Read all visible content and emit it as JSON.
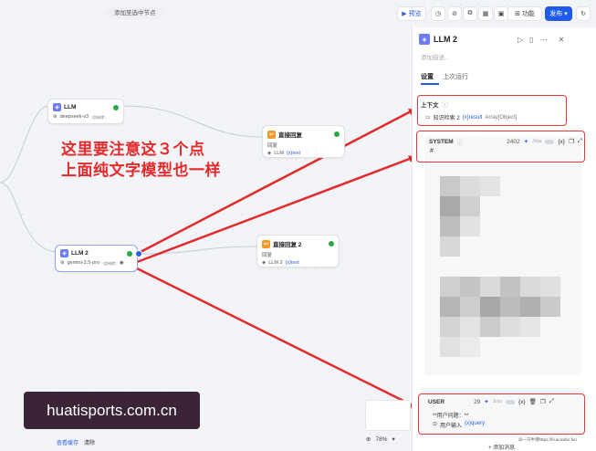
{
  "topbar": {
    "hint": "添加至选中节点",
    "preview": "预览",
    "features": "功能",
    "publish": "发布"
  },
  "canvas": {
    "llm1": {
      "title": "LLM",
      "model": "deepseek-v3",
      "tag": "CHAT"
    },
    "reply1": {
      "title": "直接回复",
      "label": "回复",
      "var_source": "LLM",
      "var_name": "{x}text"
    },
    "llm2": {
      "title": "LLM 2",
      "model": "gemini-2.5-pro",
      "tag": "CHAT"
    },
    "reply2": {
      "title": "直接回复 2",
      "label": "回复",
      "var_source": "LLM 2",
      "var_name": "{x}text"
    },
    "annotation_line1": "这里要注意这３个点",
    "annotation_line2": "上面纯文字模型也一样",
    "zoom_level": "78%",
    "bottom_links": [
      "查看缓存",
      "清除"
    ],
    "watermark": "huatisports.com.cn"
  },
  "panel": {
    "title": "LLM 2",
    "description_placeholder": "添加描述...",
    "tabs": [
      "设置",
      "上次运行"
    ],
    "context": {
      "label": "上下文",
      "source": "知识检索 2",
      "var": "{x}result",
      "type": "Array[Object]"
    },
    "system": {
      "label": "SYSTEM",
      "count": "2402",
      "jinja": "Jinja",
      "first_line": "#"
    },
    "user": {
      "label": "USER",
      "count": "29",
      "jinja": "Jinja",
      "line1": "**用户问题：**",
      "line2_source": "用户输入",
      "line2_var": "{x}query"
    },
    "add_message": "+ 添加消息",
    "credit": "@一只牛博https://hi.acowbo.fun"
  },
  "colors": {
    "accent": "#1f5bea",
    "annotation": "#e42a2a",
    "success": "#27a844"
  }
}
